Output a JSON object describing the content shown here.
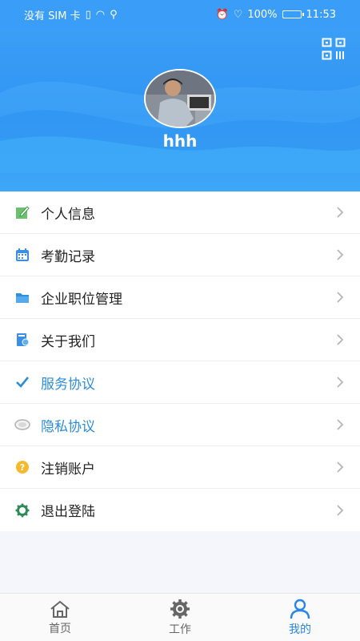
{
  "status_bar": {
    "carrier": "没有 SIM 卡",
    "battery": "100%",
    "time": "11:53"
  },
  "profile": {
    "username": "hhh",
    "avatar_icon": "user-photo",
    "qr_icon": "qr-code-icon"
  },
  "menu": [
    {
      "label": "个人信息",
      "icon": "edit-icon",
      "color": "#4caf50"
    },
    {
      "label": "考勤记录",
      "icon": "calendar-icon",
      "color": "#3a8ee6"
    },
    {
      "label": "企业职位管理",
      "icon": "folder-icon",
      "color": "#2f8fd8"
    },
    {
      "label": "关于我们",
      "icon": "book-icon",
      "color": "#3a8ee6"
    },
    {
      "label": "服务协议",
      "icon": "check-icon",
      "color": "#2d8cd9"
    },
    {
      "label": "隐私协议",
      "icon": "eye-icon",
      "color": "#bdbdbd"
    },
    {
      "label": "注销账户",
      "icon": "question-icon",
      "color": "#f5b82e"
    },
    {
      "label": "退出登陆",
      "icon": "gear-icon",
      "color": "#2e8b57"
    }
  ],
  "tabs": [
    {
      "label": "首页",
      "icon": "home-icon"
    },
    {
      "label": "工作",
      "icon": "gear-icon"
    },
    {
      "label": "我的",
      "icon": "user-icon"
    }
  ],
  "colors": {
    "primary": "#3a9df7",
    "active_tab": "#2a86e6"
  }
}
